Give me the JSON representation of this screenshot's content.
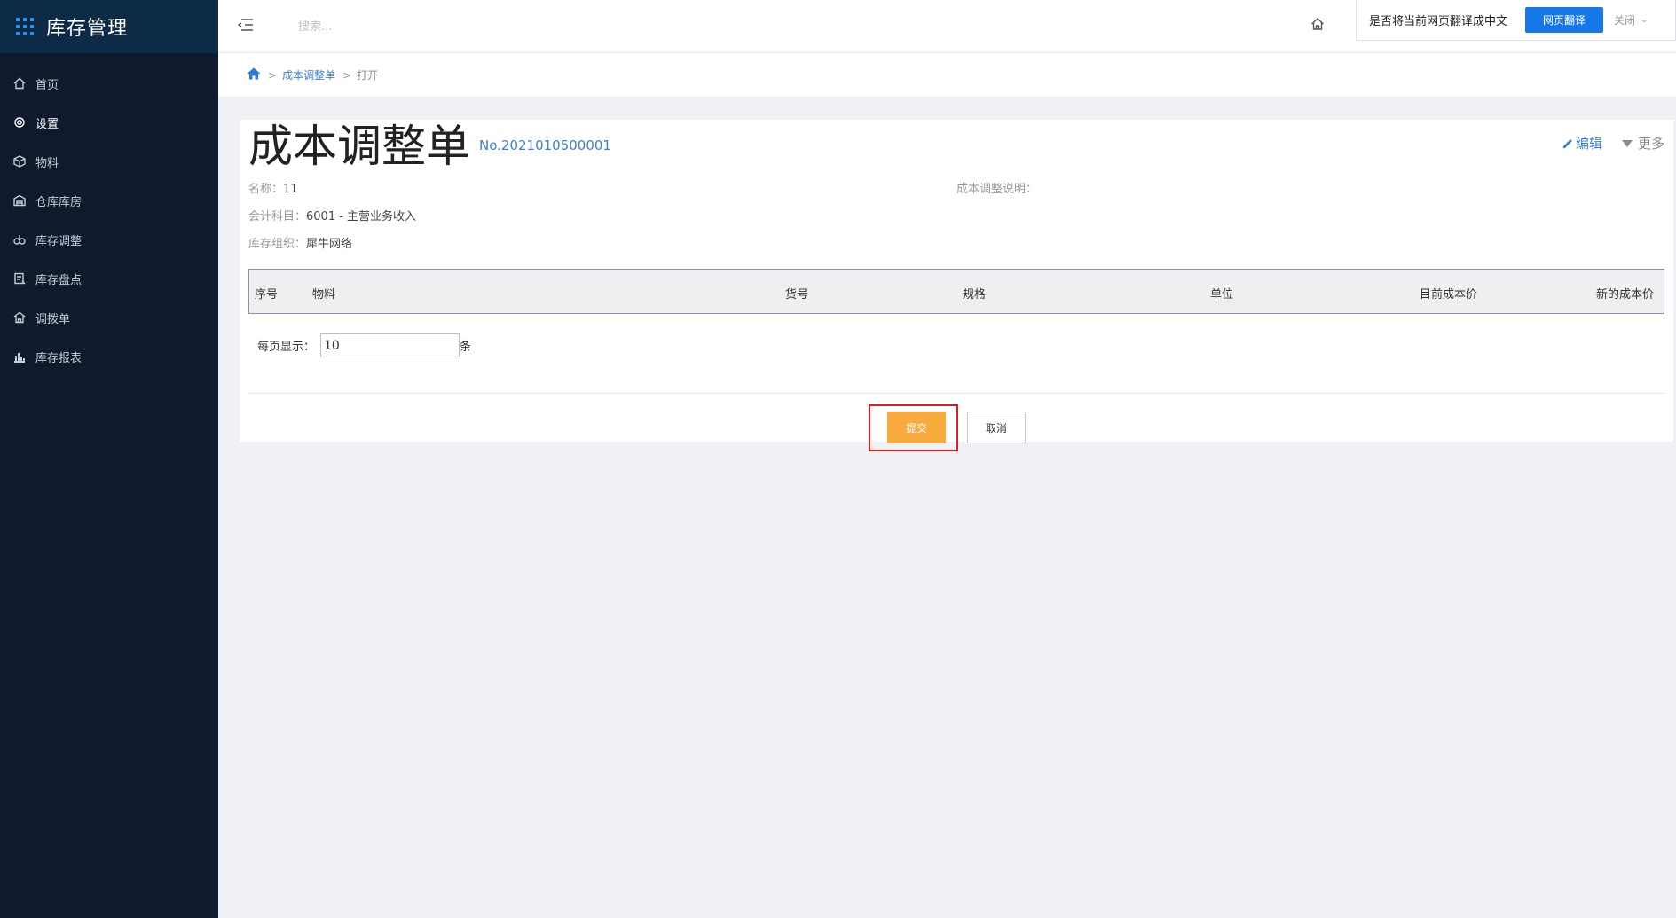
{
  "app": {
    "title": "库存管理"
  },
  "sidebar": {
    "items": [
      {
        "label": "首页",
        "icon": "home-icon"
      },
      {
        "label": "设置",
        "icon": "gear-icon"
      },
      {
        "label": "物料",
        "icon": "cube-icon"
      },
      {
        "label": "仓库库房",
        "icon": "warehouse-icon"
      },
      {
        "label": "库存调整",
        "icon": "adjust-icon"
      },
      {
        "label": "库存盘点",
        "icon": "inventory-icon"
      },
      {
        "label": "调拨单",
        "icon": "transfer-icon"
      },
      {
        "label": "库存报表",
        "icon": "bar-chart-icon"
      }
    ],
    "active_index": 1
  },
  "header": {
    "search_placeholder": "搜索..."
  },
  "translate_bar": {
    "prompt": "是否将当前网页翻译成中文",
    "translate_label": "网页翻译",
    "close_label": "关闭"
  },
  "breadcrumb": {
    "sep": ">",
    "link": "成本调整单",
    "current": "打开"
  },
  "document": {
    "title": "成本调整单",
    "number": "No.2021010500001",
    "edit_label": "编辑",
    "more_label": "更多",
    "name_label": "名称：",
    "name_value": "11",
    "desc_label": "成本调整说明：",
    "account_label": "会计科目：",
    "account_value": "6001 - 主营业务收入",
    "org_label": "库存组织：",
    "org_value": "犀牛网络"
  },
  "table": {
    "columns": [
      "序号",
      "物料",
      "货号",
      "规格",
      "单位",
      "目前成本价",
      "新的成本价"
    ]
  },
  "pager": {
    "label": "每页显示：",
    "value": "10",
    "unit": "条"
  },
  "actions": {
    "submit_label": "提交",
    "cancel_label": "取消"
  }
}
